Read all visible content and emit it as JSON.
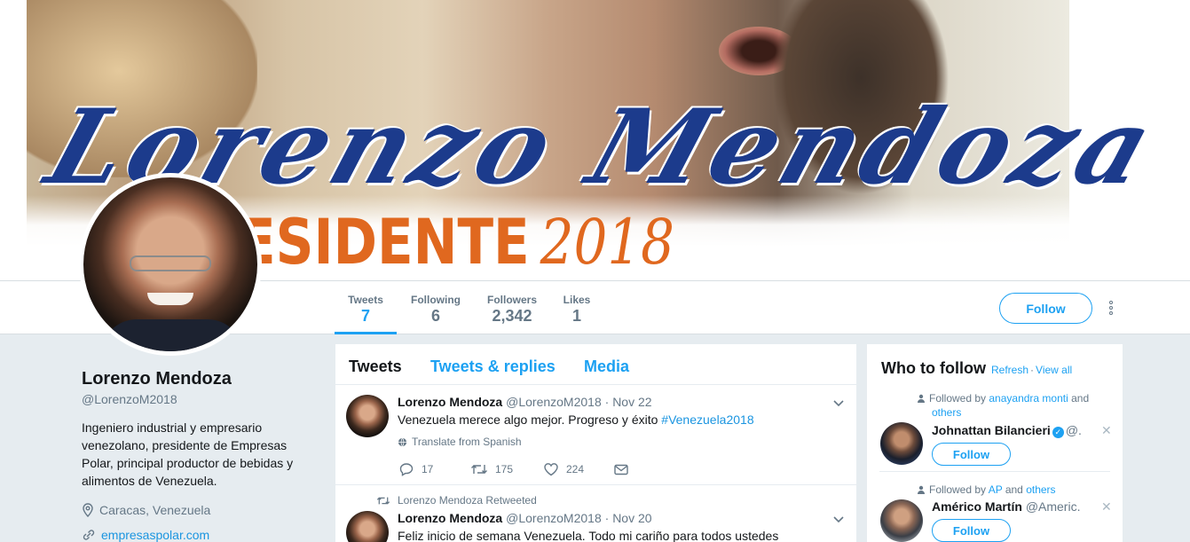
{
  "banner": {
    "title": "Lorenzo Mendoza",
    "subtitle": "ESIDENTE",
    "year": "2018"
  },
  "nav": {
    "stats": [
      {
        "label": "Tweets",
        "value": "7"
      },
      {
        "label": "Following",
        "value": "6"
      },
      {
        "label": "Followers",
        "value": "2,342"
      },
      {
        "label": "Likes",
        "value": "1"
      }
    ],
    "follow_label": "Follow"
  },
  "profile": {
    "name": "Lorenzo Mendoza",
    "handle": "@LorenzoM2018",
    "bio": "Ingeniero industrial y empresario venezolano, presidente de Empresas Polar, principal productor de bebidas y alimentos de Venezuela.",
    "location": "Caracas, Venezuela",
    "url": "empresaspolar.com"
  },
  "timeline": {
    "tabs": [
      "Tweets",
      "Tweets & replies",
      "Media"
    ],
    "tweets": [
      {
        "name": "Lorenzo Mendoza",
        "handle": "@LorenzoM2018",
        "date": "· Nov 22",
        "text": "Venezuela merece algo mejor. Progreso y éxito ",
        "hashtag": "#Venezuela2018",
        "translate": "Translate from Spanish",
        "replies": "17",
        "retweets": "175",
        "likes": "224"
      },
      {
        "retweeted_by": "Lorenzo Mendoza Retweeted",
        "name": "Lorenzo Mendoza",
        "handle": "@LorenzoM2018",
        "date": "· Nov 20",
        "text": "Feliz inicio de semana Venezuela. Todo mi cariño para todos ustedes"
      }
    ]
  },
  "who_to_follow": {
    "title": "Who to follow",
    "refresh": "Refresh",
    "view_all": "View all",
    "dot": "·",
    "items": [
      {
        "ctx_prefix": "Followed by ",
        "ctx_link": "anayandra monti",
        "ctx_mid": " and ",
        "ctx_link2": "others",
        "name": "Johnattan Bilancieri",
        "handle": "@...",
        "follow": "Follow"
      },
      {
        "ctx_prefix": "Followed by ",
        "ctx_link": "AP",
        "ctx_mid": " and ",
        "ctx_link2": "others",
        "name": "Américo Martín",
        "handle": "@Americ...",
        "follow": "Follow"
      }
    ]
  },
  "colors": {
    "accent": "#1da1f2",
    "background": "#e6ecf0",
    "banner_blue": "#1c3b8c",
    "banner_orange": "#e0681f"
  }
}
